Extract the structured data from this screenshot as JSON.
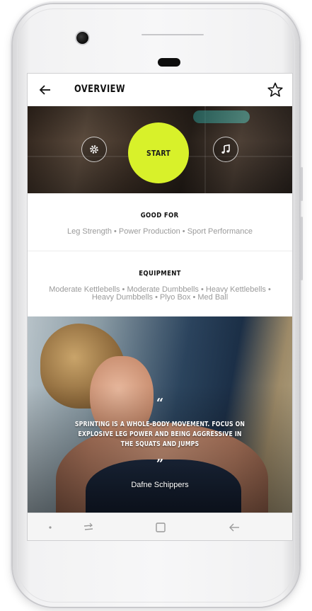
{
  "header": {
    "title": "OVERVIEW",
    "back_icon": "arrow-left-icon",
    "favorite_icon": "star-outline-icon"
  },
  "hero": {
    "start_label": "START",
    "settings_icon": "gear-icon",
    "music_icon": "music-note-icon",
    "accent_color": "#d8f12a"
  },
  "good_for": {
    "heading": "GOOD FOR",
    "text": "Leg Strength • Power Production • Sport Performance"
  },
  "equipment": {
    "heading": "EQUIPMENT",
    "text": "Moderate Kettlebells • Moderate Dumbbells • Heavy Kettlebells • Heavy Dumbbells • Plyo Box • Med Ball"
  },
  "quote": {
    "open_mark": "“",
    "close_mark": "”",
    "text": "SPRINTING IS A WHOLE-BODY MOVEMENT. FOCUS ON EXPLOSIVE LEG POWER AND BEING AGGRESSIVE IN THE SQUATS AND JUMPS",
    "author": "Dafne Schippers"
  },
  "navbar": {
    "icons": [
      "dot-icon",
      "recent-apps-icon",
      "home-square-icon",
      "back-arrow-icon"
    ]
  }
}
